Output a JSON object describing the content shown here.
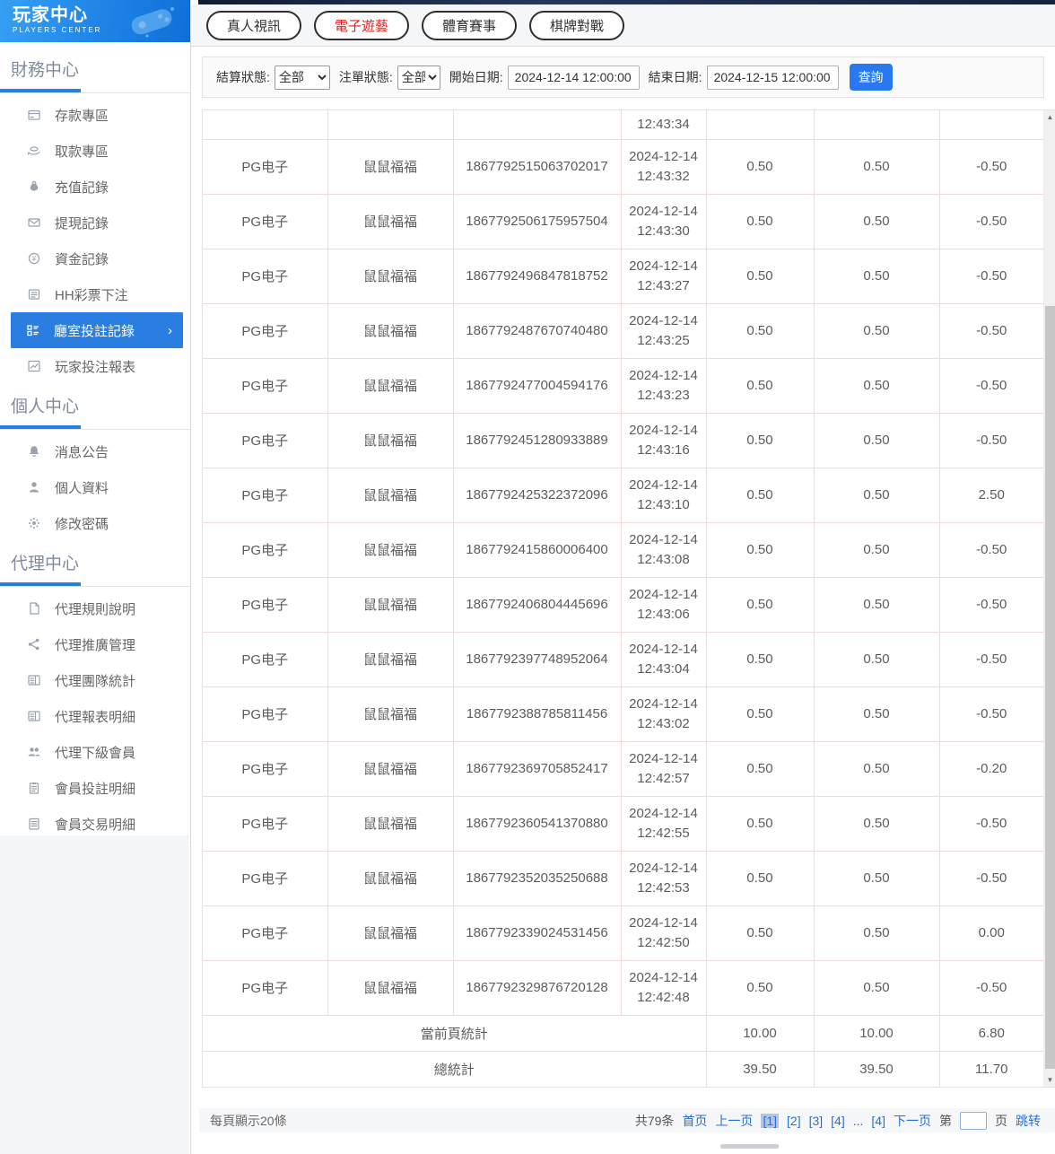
{
  "header": {
    "title": "玩家中心",
    "subtitle": "PLAYERS  CENTER",
    "logo_icon": "gamepad-icon"
  },
  "sidebar": {
    "sections": [
      {
        "title": "財務中心",
        "items": [
          {
            "key": "deposit",
            "icon": "bank-card-icon",
            "label": "存款專區"
          },
          {
            "key": "withdraw",
            "icon": "hand-cash-icon",
            "label": "取款專區"
          },
          {
            "key": "recharge-record",
            "icon": "money-bag-icon",
            "label": "充值記錄"
          },
          {
            "key": "withdrawal-record",
            "icon": "cash-envelope-icon",
            "label": "提現記錄"
          },
          {
            "key": "funds-record",
            "icon": "coin-icon",
            "label": "資金記錄"
          },
          {
            "key": "hh-lottery-bet",
            "icon": "lottery-list-icon",
            "label": "HH彩票下注"
          },
          {
            "key": "hall-bet-record",
            "icon": "org-chart-icon",
            "label": "廳室投註記錄",
            "active": true,
            "chevron": "›"
          },
          {
            "key": "player-bet-report",
            "icon": "report-chart-icon",
            "label": "玩家投注報表"
          }
        ]
      },
      {
        "title": "個人中心",
        "items": [
          {
            "key": "announcements",
            "icon": "bell-icon",
            "label": "消息公告"
          },
          {
            "key": "profile",
            "icon": "person-icon",
            "label": "個人資料"
          },
          {
            "key": "change-password",
            "icon": "gear-icon",
            "label": "修改密碼"
          }
        ]
      },
      {
        "title": "代理中心",
        "items": [
          {
            "key": "agent-rules",
            "icon": "document-icon",
            "label": "代理規則說明"
          },
          {
            "key": "agent-promotion",
            "icon": "share-icon",
            "label": "代理推廣管理"
          },
          {
            "key": "agent-team-stats",
            "icon": "newspaper-icon",
            "label": "代理團隊統計"
          },
          {
            "key": "agent-report-detail",
            "icon": "newspaper-icon",
            "label": "代理報表明細"
          },
          {
            "key": "agent-downline",
            "icon": "people-icon",
            "label": "代理下級會員"
          },
          {
            "key": "member-bet-detail",
            "icon": "clipboard-icon",
            "label": "會員投註明細"
          },
          {
            "key": "member-transactions",
            "icon": "document-lines-icon",
            "label": "會員交易明細"
          }
        ]
      }
    ]
  },
  "tabs": [
    {
      "key": "live-video",
      "label": "真人視訊"
    },
    {
      "key": "electronic-games",
      "label": "電子遊藝",
      "active": true
    },
    {
      "key": "sports-events",
      "label": "體育賽事"
    },
    {
      "key": "board-card-games",
      "label": "棋牌對戰"
    }
  ],
  "filters": {
    "settle_label": "結算狀態:",
    "settle_value": "全部",
    "order_label": "注單狀態:",
    "order_value": "全部",
    "start_label": "開始日期:",
    "start_value": "2024-12-14 12:00:00",
    "end_label": "結束日期:",
    "end_value": "2024-12-15 12:00:00",
    "search_label": "查詢",
    "accent_color": "#2878f0"
  },
  "table": {
    "partial_row_time": "12:43:34",
    "rows": [
      {
        "platform": "PG电子",
        "game": "鼠鼠福福",
        "order": "1867792515063702017",
        "date": "2024-12-14",
        "time": "12:43:32",
        "bet": "0.50",
        "valid": "0.50",
        "winloss": "-0.50"
      },
      {
        "platform": "PG电子",
        "game": "鼠鼠福福",
        "order": "1867792506175957504",
        "date": "2024-12-14",
        "time": "12:43:30",
        "bet": "0.50",
        "valid": "0.50",
        "winloss": "-0.50"
      },
      {
        "platform": "PG电子",
        "game": "鼠鼠福福",
        "order": "1867792496847818752",
        "date": "2024-12-14",
        "time": "12:43:27",
        "bet": "0.50",
        "valid": "0.50",
        "winloss": "-0.50"
      },
      {
        "platform": "PG电子",
        "game": "鼠鼠福福",
        "order": "1867792487670740480",
        "date": "2024-12-14",
        "time": "12:43:25",
        "bet": "0.50",
        "valid": "0.50",
        "winloss": "-0.50"
      },
      {
        "platform": "PG电子",
        "game": "鼠鼠福福",
        "order": "1867792477004594176",
        "date": "2024-12-14",
        "time": "12:43:23",
        "bet": "0.50",
        "valid": "0.50",
        "winloss": "-0.50"
      },
      {
        "platform": "PG电子",
        "game": "鼠鼠福福",
        "order": "1867792451280933889",
        "date": "2024-12-14",
        "time": "12:43:16",
        "bet": "0.50",
        "valid": "0.50",
        "winloss": "-0.50"
      },
      {
        "platform": "PG电子",
        "game": "鼠鼠福福",
        "order": "1867792425322372096",
        "date": "2024-12-14",
        "time": "12:43:10",
        "bet": "0.50",
        "valid": "0.50",
        "winloss": "2.50"
      },
      {
        "platform": "PG电子",
        "game": "鼠鼠福福",
        "order": "1867792415860006400",
        "date": "2024-12-14",
        "time": "12:43:08",
        "bet": "0.50",
        "valid": "0.50",
        "winloss": "-0.50"
      },
      {
        "platform": "PG电子",
        "game": "鼠鼠福福",
        "order": "1867792406804445696",
        "date": "2024-12-14",
        "time": "12:43:06",
        "bet": "0.50",
        "valid": "0.50",
        "winloss": "-0.50"
      },
      {
        "platform": "PG电子",
        "game": "鼠鼠福福",
        "order": "1867792397748952064",
        "date": "2024-12-14",
        "time": "12:43:04",
        "bet": "0.50",
        "valid": "0.50",
        "winloss": "-0.50"
      },
      {
        "platform": "PG电子",
        "game": "鼠鼠福福",
        "order": "1867792388785811456",
        "date": "2024-12-14",
        "time": "12:43:02",
        "bet": "0.50",
        "valid": "0.50",
        "winloss": "-0.50"
      },
      {
        "platform": "PG电子",
        "game": "鼠鼠福福",
        "order": "1867792369705852417",
        "date": "2024-12-14",
        "time": "12:42:57",
        "bet": "0.50",
        "valid": "0.50",
        "winloss": "-0.20"
      },
      {
        "platform": "PG电子",
        "game": "鼠鼠福福",
        "order": "1867792360541370880",
        "date": "2024-12-14",
        "time": "12:42:55",
        "bet": "0.50",
        "valid": "0.50",
        "winloss": "-0.50"
      },
      {
        "platform": "PG电子",
        "game": "鼠鼠福福",
        "order": "1867792352035250688",
        "date": "2024-12-14",
        "time": "12:42:53",
        "bet": "0.50",
        "valid": "0.50",
        "winloss": "-0.50"
      },
      {
        "platform": "PG电子",
        "game": "鼠鼠福福",
        "order": "1867792339024531456",
        "date": "2024-12-14",
        "time": "12:42:50",
        "bet": "0.50",
        "valid": "0.50",
        "winloss": "0.00"
      },
      {
        "platform": "PG电子",
        "game": "鼠鼠福福",
        "order": "1867792329876720128",
        "date": "2024-12-14",
        "time": "12:42:48",
        "bet": "0.50",
        "valid": "0.50",
        "winloss": "-0.50"
      }
    ],
    "summary": [
      {
        "label": "當前頁統計",
        "bet": "10.00",
        "valid": "10.00",
        "winloss": "6.80"
      },
      {
        "label": "總統計",
        "bet": "39.50",
        "valid": "39.50",
        "winloss": "11.70"
      }
    ]
  },
  "pagination": {
    "per_page": "每頁顯示20條",
    "total": "共79条",
    "links": [
      {
        "label": "首页"
      },
      {
        "label": "上一页"
      },
      {
        "label": "[1]",
        "active": true
      },
      {
        "label": "[2]"
      },
      {
        "label": "[3]"
      },
      {
        "label": "[4]"
      },
      {
        "label": "..."
      },
      {
        "label": "[4]"
      },
      {
        "label": "下一页"
      }
    ],
    "jump_prefix": "第",
    "jump_suffix": "页",
    "jump_action": "跳转"
  }
}
